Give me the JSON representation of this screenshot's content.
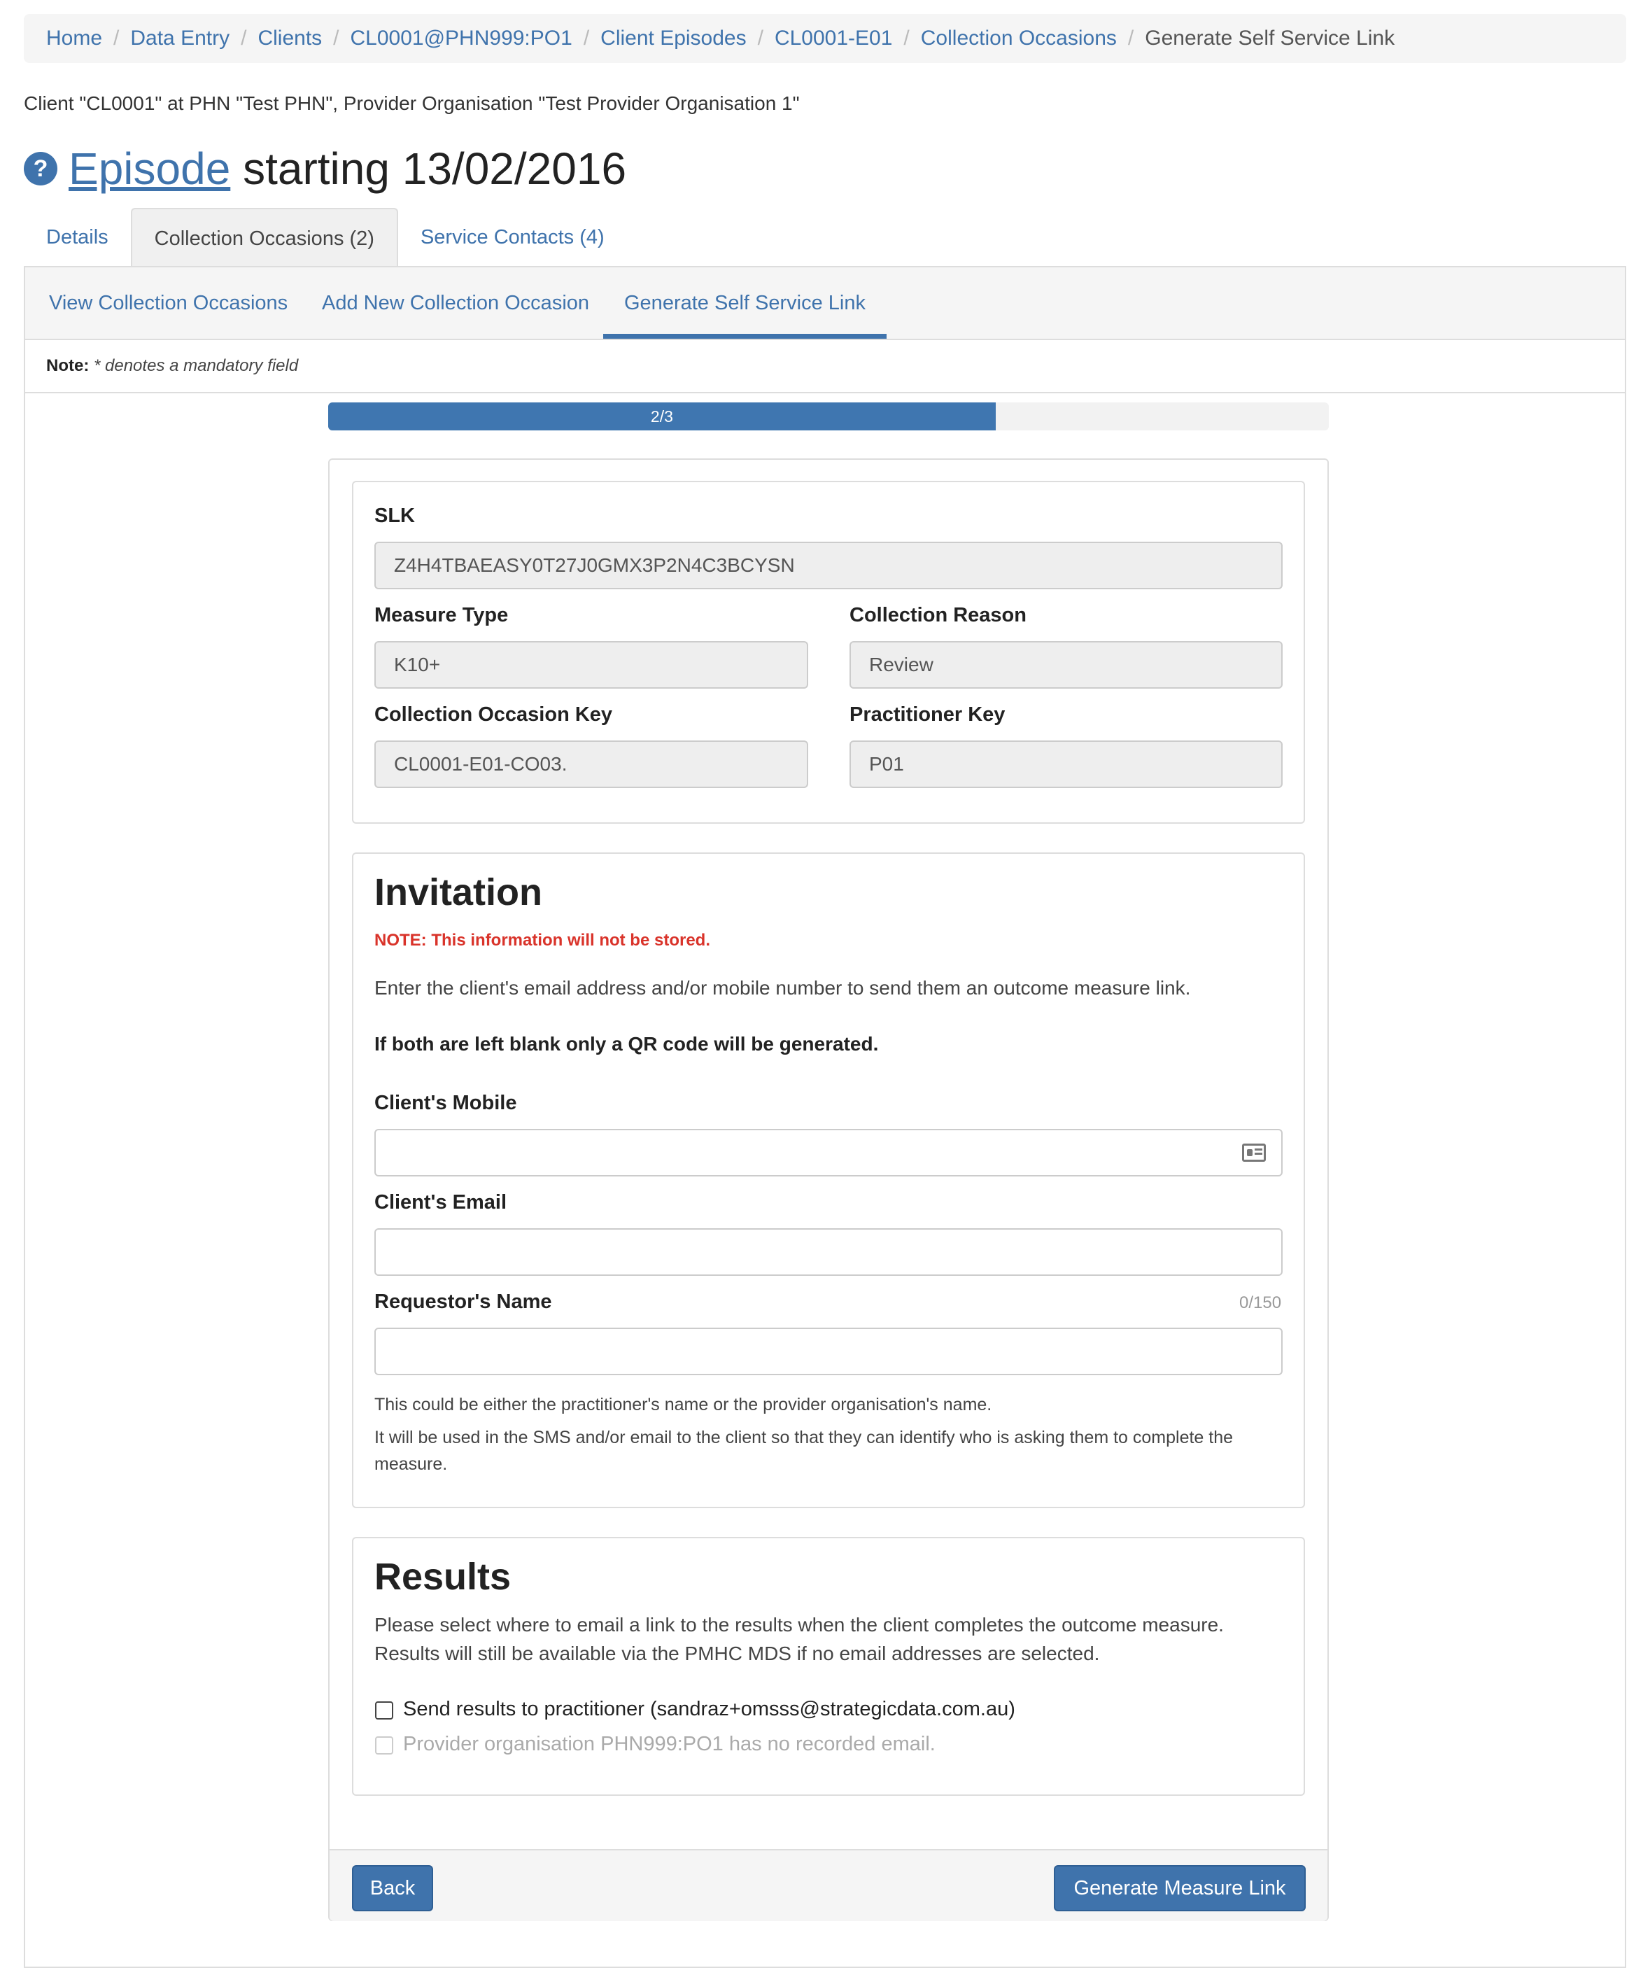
{
  "breadcrumb": [
    {
      "label": "Home"
    },
    {
      "label": "Data Entry"
    },
    {
      "label": "Clients"
    },
    {
      "label": "CL0001@PHN999:PO1"
    },
    {
      "label": "Client Episodes"
    },
    {
      "label": "CL0001-E01"
    },
    {
      "label": "Collection Occasions"
    },
    {
      "label": "Generate Self Service Link"
    }
  ],
  "context_text": "Client \"CL0001\" at PHN \"Test PHN\", Provider Organisation \"Test Provider Organisation 1\"",
  "title": {
    "link": "Episode",
    "rest": " starting 13/02/2016",
    "help": "?"
  },
  "tabs": [
    {
      "label": "Details"
    },
    {
      "label": "Collection Occasions (2)"
    },
    {
      "label": "Service Contacts (4)"
    }
  ],
  "subtabs": [
    {
      "label": "View Collection Occasions"
    },
    {
      "label": "Add New Collection Occasion"
    },
    {
      "label": "Generate Self Service Link"
    }
  ],
  "note": {
    "bold": "Note:",
    "italic": "* denotes a mandatory field"
  },
  "progress": {
    "label": "2/3",
    "fraction": 0.667
  },
  "details": {
    "slk_label": "SLK",
    "slk_value": "Z4H4TBAEASY0T27J0GMX3P2N4C3BCYSN",
    "measure_type_label": "Measure Type",
    "measure_type_value": "K10+",
    "collection_reason_label": "Collection Reason",
    "collection_reason_value": "Review",
    "co_key_label": "Collection Occasion Key",
    "co_key_value": "CL0001-E01-CO03.",
    "practitioner_key_label": "Practitioner Key",
    "practitioner_key_value": "P01"
  },
  "invitation": {
    "heading": "Invitation",
    "warning": "NOTE: This information will not be stored.",
    "intro": "Enter the client's email address and/or mobile number to send them an outcome measure link.",
    "bold_note": "If both are left blank only a QR code will be generated.",
    "mobile_label": "Client's Mobile",
    "mobile_value": "",
    "email_label": "Client's Email",
    "email_value": "",
    "requestor_label": "Requestor's Name",
    "requestor_counter": "0/150",
    "requestor_value": "",
    "help1": "This could be either the practitioner's name or the provider organisation's name.",
    "help2": "It will be used in the SMS and/or email to the client so that they can identify who is asking them to complete the measure."
  },
  "results": {
    "heading": "Results",
    "line1": "Please select where to email a link to the results when the client completes the outcome measure.",
    "line2": "Results will still be available via the PMHC MDS if no email addresses are selected.",
    "option1": "Send results to practitioner (sandraz+omsss@strategicdata.com.au)",
    "option2": "Provider organisation PHN999:PO1 has no recorded email."
  },
  "buttons": {
    "back": "Back",
    "generate": "Generate Measure Link"
  },
  "colors": {
    "primary": "#3f73ac",
    "warning": "#d9332a"
  }
}
